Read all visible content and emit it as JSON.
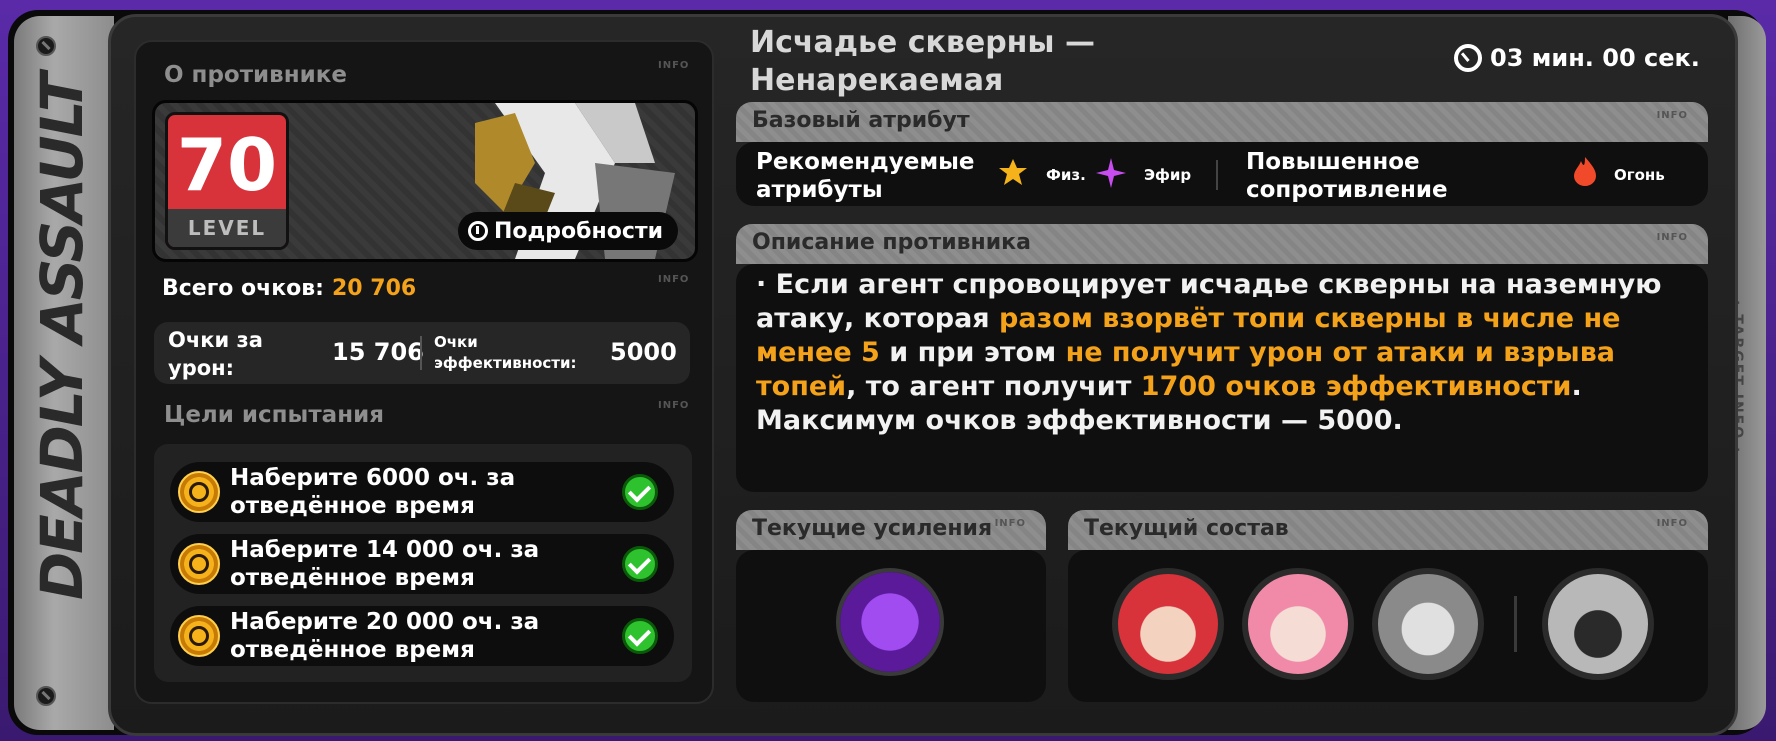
{
  "sidebar": {
    "title": "DEADLY ASSAULT",
    "right_tag": "· TARGET INFO ·"
  },
  "enemy_panel": {
    "section_title": "О противнике",
    "info": "INFO",
    "level_number": "70",
    "level_word": "LEVEL",
    "details_button": "Подробности",
    "total_label": "Всего очков:",
    "total_value": "20 706",
    "damage_label": "Очки за урон:",
    "damage_value": "15 706",
    "efficiency_label": "Очки эффективности:",
    "efficiency_value": "5000"
  },
  "goals": {
    "section_title": "Цели испытания",
    "items": [
      {
        "text": "Наберите 6000 оч. за отведённое время",
        "done": true
      },
      {
        "text": "Наберите 14 000 оч. за отведённое время",
        "done": true
      },
      {
        "text": "Наберите 20 000 оч. за отведённое время",
        "done": true
      }
    ]
  },
  "header": {
    "enemy_name_line1": "Исчадье скверны —",
    "enemy_name_line2": "Ненарекаемая",
    "timer": "03 мин. 00 сек."
  },
  "attributes": {
    "title": "Базовый атрибут",
    "recommended_label": "Рекомендуемые атрибуты",
    "physical": "Физ.",
    "ether": "Эфир",
    "resistance_label": "Повышенное сопротивление",
    "fire": "Огонь"
  },
  "description": {
    "title": "Описание противника",
    "part1": "· Если агент спровоцирует исчадье скверны на наземную атаку, которая ",
    "hl1": "разом взорвёт топи скверны в числе не менее 5",
    "part2": " и при этом ",
    "hl2": "не получит урон от атаки и взрыва топей",
    "part3": ", то агент получит ",
    "hl3": "1700 очков эффективности",
    "part4": ". Максимум очков эффективности — 5000."
  },
  "buffs": {
    "title": "Текущие усиления"
  },
  "team": {
    "title": "Текущий состав"
  },
  "colors": {
    "accent": "#f5a21b",
    "level_red": "#d8323a",
    "check_green": "#2ec22e"
  }
}
